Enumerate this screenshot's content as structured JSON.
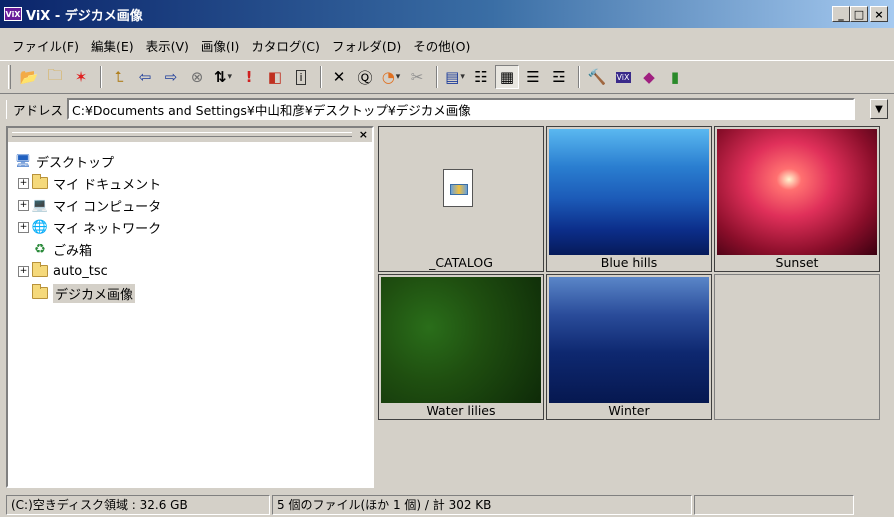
{
  "window": {
    "app_icon_text": "ViX",
    "title": "ViX - デジカメ画像",
    "minimize": "_",
    "maximize": "□",
    "close": "×"
  },
  "menu": [
    "ファイル(F)",
    "編集(E)",
    "表示(V)",
    "画像(I)",
    "カタログ(C)",
    "フォルダ(D)",
    "その他(O)"
  ],
  "toolbar": {
    "icons": [
      "open-folder-icon",
      "new-folder-icon",
      "star-icon",
      "up-folder-icon",
      "back-arrow-icon",
      "forward-arrow-icon",
      "stop-icon",
      "sort-icon",
      "mark-icon",
      "slideshow-icon",
      "info-icon",
      "delete-icon",
      "properties-icon",
      "color-icon",
      "cut-icon",
      "view-icon",
      "details-icon",
      "large-icons-icon",
      "small-icons-icon",
      "list-icon",
      "tools-icon",
      "vix-icon",
      "book-icon",
      "exit-icon"
    ]
  },
  "address": {
    "label": "アドレス",
    "value": "C:¥Documents and Settings¥中山和彦¥デスクトップ¥デジカメ画像"
  },
  "tree": {
    "close": "×",
    "items": [
      {
        "label": "デスクトップ",
        "expander": "",
        "icon": "desktop-icon"
      },
      {
        "label": "マイ ドキュメント",
        "expander": "+",
        "icon": "my-documents-icon"
      },
      {
        "label": "マイ コンピュータ",
        "expander": "+",
        "icon": "my-computer-icon"
      },
      {
        "label": "マイ ネットワーク",
        "expander": "+",
        "icon": "my-network-icon"
      },
      {
        "label": "ごみ箱",
        "expander": "",
        "icon": "recycle-bin-icon"
      },
      {
        "label": "auto_tsc",
        "expander": "+",
        "icon": "folder-icon"
      },
      {
        "label": "デジカメ画像",
        "expander": "",
        "icon": "open-folder-icon"
      }
    ]
  },
  "thumbnails": [
    {
      "caption": "_CATALOG"
    },
    {
      "caption": "Blue hills"
    },
    {
      "caption": "Sunset"
    },
    {
      "caption": "Water lilies"
    },
    {
      "caption": "Winter"
    }
  ],
  "status": {
    "disk": "(C:)空きディスク領域 : 32.6 GB",
    "files": "5 個のファイル(ほか 1 個) / 計 302 KB",
    "extra": ""
  }
}
